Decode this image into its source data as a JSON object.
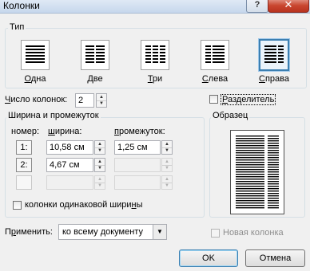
{
  "window": {
    "title": "Колонки",
    "help_glyph": "?",
    "close_glyph": "✕"
  },
  "type_group": {
    "label": "Тип",
    "presets": [
      {
        "label": "Одна",
        "underline": "О",
        "rest": "дна",
        "selected": false
      },
      {
        "label": "Две",
        "underline": "Д",
        "rest": "ве",
        "selected": false
      },
      {
        "label": "Три",
        "underline": "Т",
        "rest": "ри",
        "selected": false
      },
      {
        "label": "Слева",
        "underline": "С",
        "rest": "лева",
        "selected": false
      },
      {
        "label": "Справа",
        "underline": "С",
        "rest": "права",
        "selected": true
      }
    ]
  },
  "columns": {
    "label_ul": "Ч",
    "label_rest": "исло колонок:",
    "value": "2"
  },
  "separator": {
    "label_ul": "Р",
    "label_rest": "азделитель",
    "checked": false
  },
  "width_group": {
    "label": "Ширина и промежуток",
    "col_number": "номер:",
    "col_width_ul": "ш",
    "col_width_rest": "ирина:",
    "col_spacing_ul": "п",
    "col_spacing_rest": "ромежуток:",
    "rows": [
      {
        "num": "1:",
        "width": "10,58 см",
        "spacing": "1,25 см"
      },
      {
        "num": "2:",
        "width": "4,67 см",
        "spacing": ""
      },
      {
        "num": "",
        "width": "",
        "spacing": ""
      }
    ],
    "equal_width_label_main": "колонки одинаковой шири",
    "equal_width_label_ul": "н",
    "equal_width_label_end": "ы",
    "equal_width_checked": false
  },
  "preview": {
    "label": "Образец"
  },
  "apply": {
    "label_pre": "П",
    "label_ul": "р",
    "label_rest": "именить:",
    "value": "ко всему документу"
  },
  "new_column": {
    "label": "Новая колонка",
    "checked": false,
    "enabled": false
  },
  "buttons": {
    "ok": "OK",
    "cancel": "Отмена"
  },
  "colors": {
    "accent": "#3c7fb1",
    "disabled": "#8d8d8d"
  }
}
